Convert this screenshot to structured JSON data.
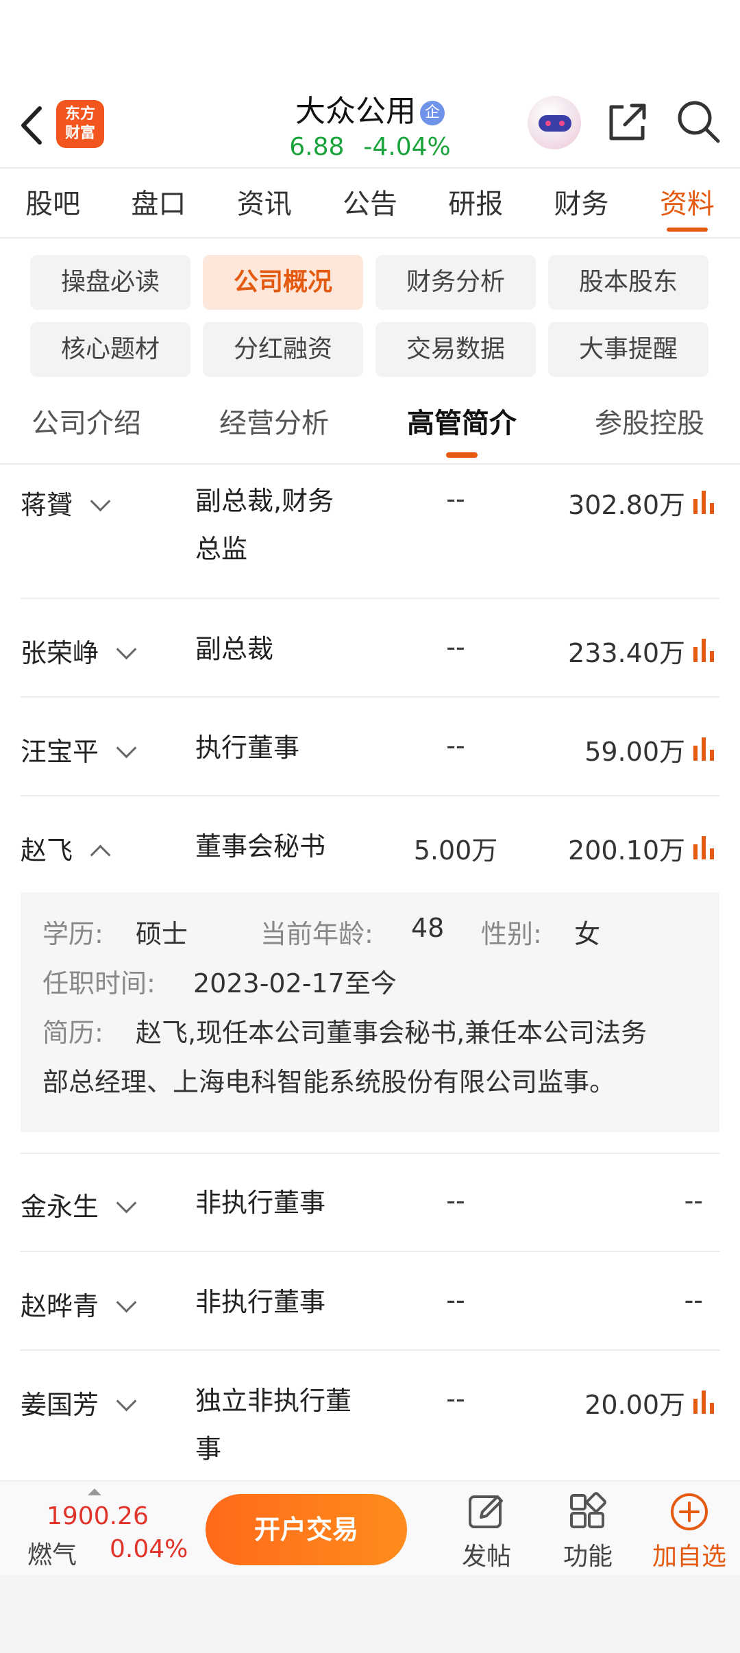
{
  "header": {
    "logo_text": "东方\n财富",
    "stock_name": "大众公用",
    "badge": "企",
    "price": "6.88",
    "change_pct": "-4.04%"
  },
  "tabs": [
    "股吧",
    "盘口",
    "资讯",
    "公告",
    "研报",
    "财务",
    "资料"
  ],
  "active_tab": "资料",
  "chips": [
    "操盘必读",
    "公司概况",
    "财务分析",
    "股本股东",
    "核心题材",
    "分红融资",
    "交易数据",
    "大事提醒"
  ],
  "active_chip": "公司概况",
  "subtabs": [
    "公司介绍",
    "经营分析",
    "高管简介",
    "参股控股"
  ],
  "active_subtab": "高管简介",
  "executives": [
    {
      "name": "蒋贇",
      "position_l1": "副总裁,财务",
      "position_l2": "总监",
      "holding": "--",
      "pay": "302.80万"
    },
    {
      "name": "张荣峥",
      "position_l1": "副总裁",
      "position_l2": "",
      "holding": "--",
      "pay": "233.40万"
    },
    {
      "name": "汪宝平",
      "position_l1": "执行董事",
      "position_l2": "",
      "holding": "--",
      "pay": "59.00万"
    },
    {
      "name": "赵飞",
      "position_l1": "董事会秘书",
      "position_l2": "",
      "holding": "5.00万",
      "pay": "200.10万"
    },
    {
      "name": "金永生",
      "position_l1": "非执行董事",
      "position_l2": "",
      "holding": "--",
      "pay": "--"
    },
    {
      "name": "赵晔青",
      "position_l1": "非执行董事",
      "position_l2": "",
      "holding": "--",
      "pay": "--"
    },
    {
      "name": "姜国芳",
      "position_l1": "独立非执行董",
      "position_l2": "事",
      "holding": "--",
      "pay": "20.00万"
    }
  ],
  "detail": {
    "edu_label": "学历:",
    "edu": "硕士",
    "age_label": "当前年龄:",
    "age": "48",
    "gender_label": "性别:",
    "gender": "女",
    "tenure_label": "任职时间:",
    "tenure": "2023-02-17至今",
    "bio_label": "简历:",
    "bio_l1": "赵飞,现任本公司董事会秘书,兼任本公司法务",
    "bio_l2": "部总经理、上海电科智能系统股份有限公司监事。"
  },
  "bottom": {
    "index_value": "1900.26",
    "index_name": "燃气",
    "index_pct": "0.04%",
    "open_button": "开户交易",
    "post_label": "发帖",
    "func_label": "功能",
    "add_label": "加自选"
  },
  "colors": {
    "accent": "#e35a10",
    "down": "#19a33a",
    "up": "#e0342b"
  }
}
